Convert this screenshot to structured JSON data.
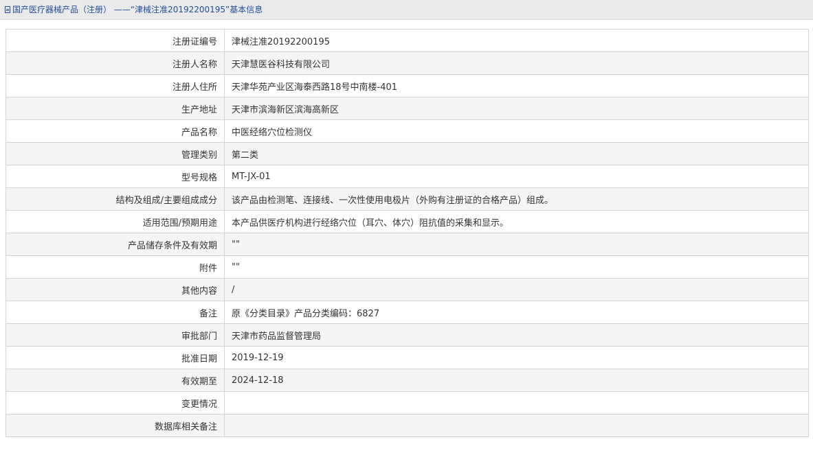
{
  "breadcrumb": {
    "icon": "document-icon",
    "category": "国产医疗器械产品（注册）",
    "separator": "——",
    "page": "“津械注准20192200195”基本信息"
  },
  "rows": [
    {
      "label": "注册证编号",
      "value": "津械注准20192200195"
    },
    {
      "label": "注册人名称",
      "value": "天津慧医谷科技有限公司"
    },
    {
      "label": "注册人住所",
      "value": "天津华苑产业区海泰西路18号中南楼-401"
    },
    {
      "label": "生产地址",
      "value": "天津市滨海新区滨海高新区"
    },
    {
      "label": "产品名称",
      "value": "中医经络穴位检测仪"
    },
    {
      "label": "管理类别",
      "value": "第二类"
    },
    {
      "label": "型号规格",
      "value": "MT-JX-01"
    },
    {
      "label": "结构及组成/主要组成成分",
      "value": "该产品由检测笔、连接线、一次性使用电极片（外购有注册证的合格产品）组成。"
    },
    {
      "label": "适用范围/预期用途",
      "value": "本产品供医疗机构进行经络穴位（耳穴、体穴）阻抗值的采集和显示。"
    },
    {
      "label": "产品储存条件及有效期",
      "value": "\"\""
    },
    {
      "label": "附件",
      "value": "\"\""
    },
    {
      "label": "其他内容",
      "value": "/"
    },
    {
      "label": "备注",
      "value": "原《分类目录》产品分类编码：6827"
    },
    {
      "label": "审批部门",
      "value": "天津市药品监督管理局"
    },
    {
      "label": "批准日期",
      "value": "2019-12-19"
    },
    {
      "label": "有效期至",
      "value": "2024-12-18"
    },
    {
      "label": "变更情况",
      "value": ""
    },
    {
      "label": "数据库相关备注",
      "value": ""
    }
  ]
}
